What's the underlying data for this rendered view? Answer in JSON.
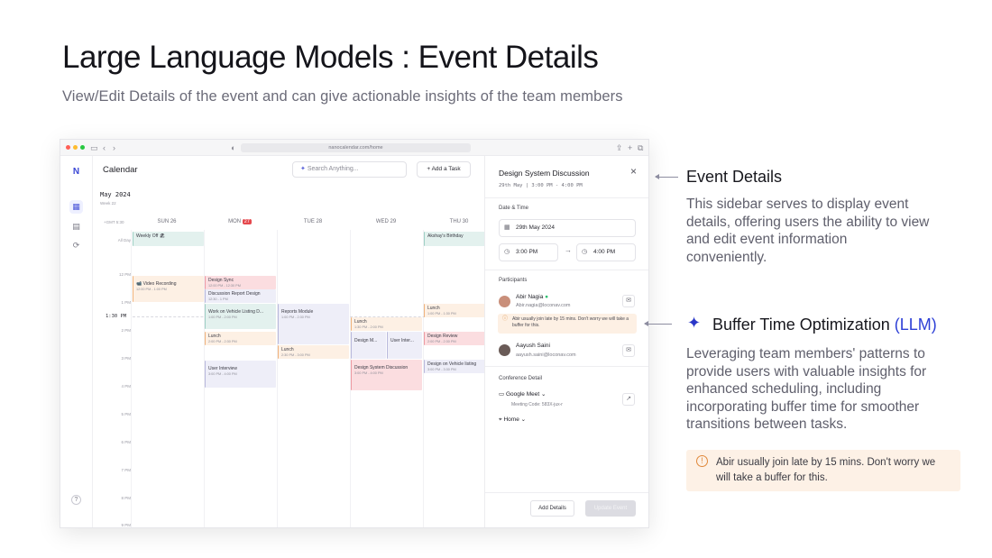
{
  "page": {
    "title": "Large Language Models : Event Details",
    "subtitle": "View/Edit Details of the event and can give actionable insights of the team members"
  },
  "browser": {
    "url": "nanocalendar.com/home"
  },
  "calendar": {
    "title": "Calendar",
    "search_placeholder": "Search Anything...",
    "add_task": "Add a Task",
    "month": "May 2024",
    "week": "Week 22",
    "timezone": "+GMT 5:30",
    "all_day": "All Day",
    "now_label": "1:30 PM",
    "days": [
      {
        "label": "SUN 26",
        "badge": ""
      },
      {
        "label": "MON",
        "badge": "27"
      },
      {
        "label": "TUE 28",
        "badge": ""
      },
      {
        "label": "WED 29",
        "badge": ""
      },
      {
        "label": "THU 30",
        "badge": ""
      }
    ],
    "times": [
      "12 PM",
      "1 PM",
      "2 PM",
      "3 PM",
      "4 PM",
      "5 PM",
      "6 PM",
      "7 PM",
      "8 PM",
      "9 PM"
    ],
    "events": [
      {
        "title": "Weekly Off 🏖",
        "sub": ""
      },
      {
        "title": "Akshay's Birthday",
        "sub": ""
      },
      {
        "title": "📹 Video Recording",
        "sub": "12:00 PM - 1:00 PM"
      },
      {
        "title": "Design Sync",
        "sub": "12:00 PM - 12:30 PM"
      },
      {
        "title": "Discussion Report Design",
        "sub": "12:30 - 1 PM"
      },
      {
        "title": "Work on Vehicle Listing D...",
        "sub": "1:00 PM - 2:00 PM"
      },
      {
        "title": "Reports Module",
        "sub": "1:00 PM - 2:30 PM"
      },
      {
        "title": "Lunch",
        "sub": "2:00 PM - 2:30 PM"
      },
      {
        "title": "Lunch",
        "sub": "2:30 PM - 3:00 PM"
      },
      {
        "title": "User Interview",
        "sub": "3:00 PM - 4:00 PM"
      },
      {
        "title": "Lunch",
        "sub": "1:30 PM - 2:00 PM"
      },
      {
        "title": "Design M...",
        "sub": ""
      },
      {
        "title": "User Inter...",
        "sub": ""
      },
      {
        "title": "Design System Discussion",
        "sub": "3:00 PM - 4:00 PM"
      },
      {
        "title": "Lunch",
        "sub": "1:00 PM - 1:30 PM"
      },
      {
        "title": "Design Review",
        "sub": "2:00 PM - 2:30 PM"
      },
      {
        "title": "Design on Vehicle listing",
        "sub": "3:00 PM - 3:30 PM"
      }
    ]
  },
  "panel": {
    "title": "Design System Discussion",
    "subtitle": "29th May | 3:00 PM - 4:00 PM",
    "date_time_label": "Date & Time",
    "date": "29th May 2024",
    "start": "3:00 PM",
    "end": "4:00 PM",
    "participants_label": "Participants",
    "participants": [
      {
        "name": "Abir Nagia",
        "email": "Abir.nagia@loconav.com"
      },
      {
        "name": "Aayush Saini",
        "email": "aayush.saini@loconav.com"
      }
    ],
    "insight": "Abir usually join late by 15 mins. Don't worry we will take a buffer for this.",
    "conference_label": "Conference Detail",
    "conference": "Google Meet",
    "meeting_code": "Meeting Code: 583X-jux-r",
    "location": "Home",
    "add_details": "Add Details",
    "update": "Update Event"
  },
  "annotations": {
    "event_details_title": "Event Details",
    "event_details_text": "This sidebar serves to display event details, offering users the ability to view and edit event information conveniently.",
    "buffer_title": "Buffer Time Optimization",
    "buffer_tag": "(LLM)",
    "buffer_text": "Leveraging team members' patterns to provide users with valuable insights for enhanced scheduling, including incorporating buffer time for smoother transitions between tasks.",
    "note": "Abir usually join late by 15 mins. Don't worry we will take a buffer for this."
  },
  "colors": {
    "accent": "#2d3fd6",
    "note_bg": "#fdf1e6",
    "today_badge": "#e5484d"
  }
}
